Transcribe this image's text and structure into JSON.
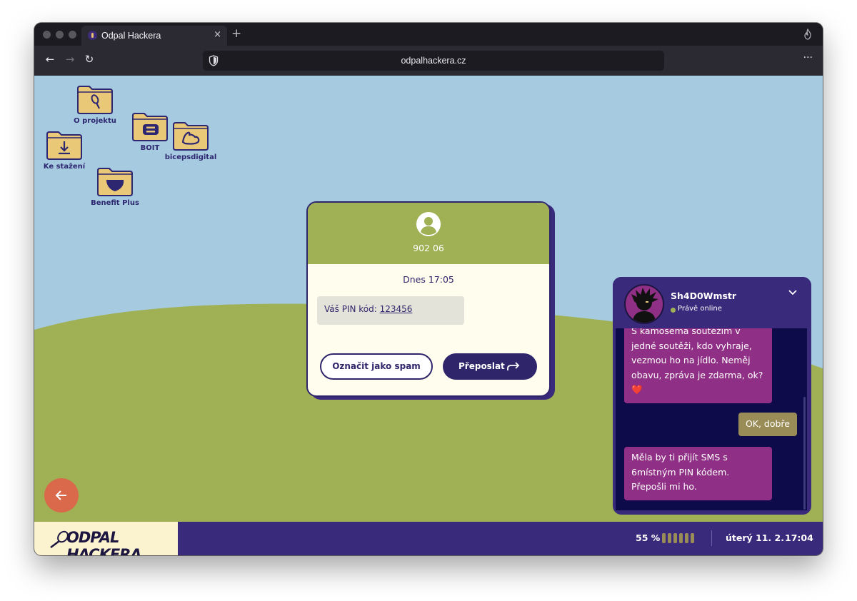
{
  "colors": {
    "sky": "#a6cbe0",
    "hill": "#9fb055",
    "accent_purple": "#3a2a7c",
    "folder": "#e9c878",
    "back_button": "#d9694a"
  },
  "browser": {
    "tab_title": "Odpal Hackera",
    "tab_close": "×",
    "new_tab": "+",
    "back": "←",
    "forward": "→",
    "reload": "↻",
    "url": "odpalhackera.cz",
    "menu": "···"
  },
  "desktop": {
    "icons": [
      {
        "label": "O projektu",
        "icon": "racket-icon"
      },
      {
        "label": "BOIT",
        "icon": "b-logo-icon"
      },
      {
        "label": "bicepsdigital",
        "icon": "biceps-icon"
      },
      {
        "label": "Ke stažení",
        "icon": "download-icon"
      },
      {
        "label": "Benefit Plus",
        "icon": "shield-logo-icon"
      }
    ]
  },
  "sms": {
    "sender": "902 06",
    "date": "Dnes 17:05",
    "message_prefix": "Váš PIN kód: ",
    "pin": "123456",
    "spam_button": "Označit jako spam",
    "forward_button": "Přeposlat"
  },
  "chat": {
    "name": "Sh4D0Wmstr",
    "status": "Právě online",
    "messages": [
      {
        "from": "them",
        "text": "S kámošema soutěžím v jedné soutěži, kdo vyhraje, vezmou ho na jídlo. Neměj obavu, zpráva je zdarma, ok? ❤️"
      },
      {
        "from": "me",
        "text": "OK, dobře"
      },
      {
        "from": "them",
        "text": "Měla by ti přijít SMS s 6místným PIN kódem. Přepošli mi ho."
      }
    ]
  },
  "taskbar": {
    "logo": "ODPAL HACKERA",
    "battery_percent": 55,
    "battery_label": "55 %",
    "battery_segments": 6,
    "date": "úterý 11. 2.",
    "time": "17:04"
  }
}
